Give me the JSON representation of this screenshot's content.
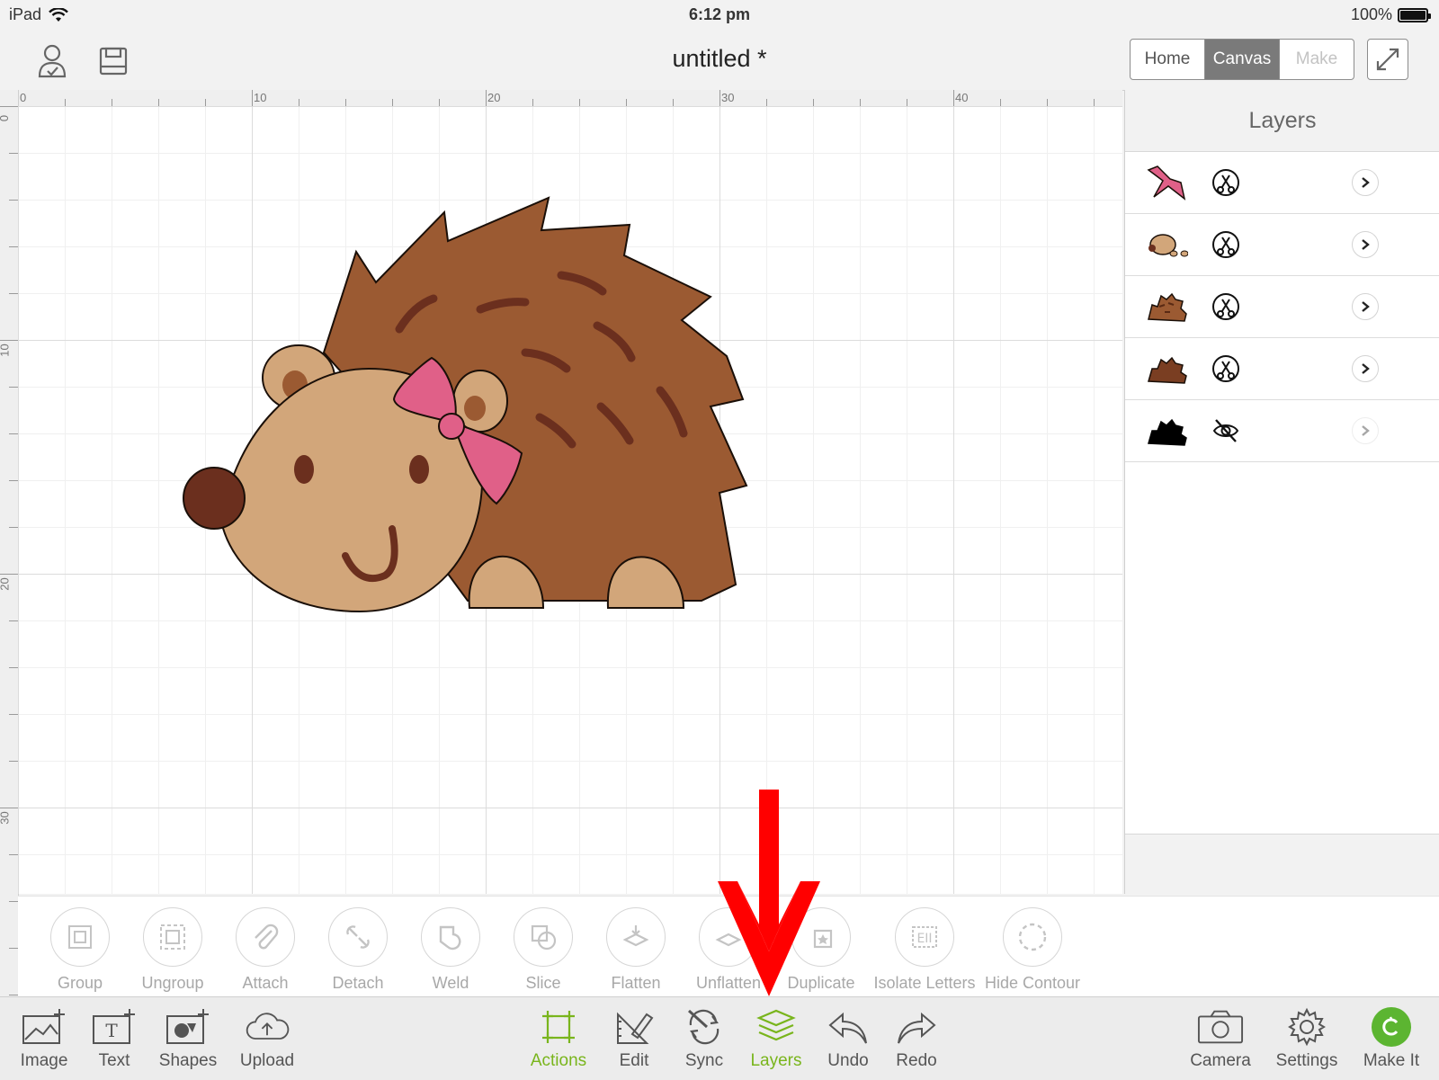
{
  "status": {
    "device": "iPad",
    "time": "6:12 pm",
    "battery": "100%"
  },
  "nav": {
    "title": "untitled *",
    "tabs": [
      {
        "label": "Home"
      },
      {
        "label": "Canvas"
      },
      {
        "label": "Make"
      }
    ],
    "active_tab": "Canvas"
  },
  "ruler": {
    "top": [
      "0",
      "10",
      "20",
      "30",
      "40"
    ],
    "left": [
      "0",
      "10",
      "20",
      "30"
    ]
  },
  "layers": {
    "title": "Layers",
    "items": [
      {
        "thumb": "bow-layer",
        "op": "cut",
        "visible": true,
        "thumb_color": "#e06088"
      },
      {
        "thumb": "face-layer",
        "op": "cut",
        "visible": true,
        "thumb_color": "#d2a67a"
      },
      {
        "thumb": "spikes-detail-layer",
        "op": "cut",
        "visible": true,
        "thumb_color": "#9b5a32"
      },
      {
        "thumb": "body-layer",
        "op": "cut",
        "visible": true,
        "thumb_color": "#7a3e22"
      },
      {
        "thumb": "shadow-layer",
        "op": "hidden",
        "visible": false,
        "thumb_color": "#000000"
      }
    ]
  },
  "actions": [
    {
      "label": "Group",
      "icon": "group-icon"
    },
    {
      "label": "Ungroup",
      "icon": "ungroup-icon"
    },
    {
      "label": "Attach",
      "icon": "paperclip-icon"
    },
    {
      "label": "Detach",
      "icon": "detach-icon"
    },
    {
      "label": "Weld",
      "icon": "weld-icon"
    },
    {
      "label": "Slice",
      "icon": "slice-icon"
    },
    {
      "label": "Flatten",
      "icon": "flatten-icon"
    },
    {
      "label": "Unflatten",
      "icon": "unflatten-icon"
    },
    {
      "label": "Duplicate",
      "icon": "duplicate-icon"
    },
    {
      "label": "Isolate Letters",
      "icon": "isolate-letters-icon"
    },
    {
      "label": "Hide Contour",
      "icon": "hide-contour-icon"
    }
  ],
  "toolbar": {
    "left": [
      {
        "label": "Image",
        "icon": "image-icon"
      },
      {
        "label": "Text",
        "icon": "text-icon"
      },
      {
        "label": "Shapes",
        "icon": "shapes-icon"
      },
      {
        "label": "Upload",
        "icon": "upload-icon"
      }
    ],
    "center": [
      {
        "label": "Actions",
        "icon": "actions-icon",
        "active": true
      },
      {
        "label": "Edit",
        "icon": "edit-icon"
      },
      {
        "label": "Sync",
        "icon": "sync-icon"
      },
      {
        "label": "Layers",
        "icon": "layers-icon",
        "active": true
      },
      {
        "label": "Undo",
        "icon": "undo-icon"
      },
      {
        "label": "Redo",
        "icon": "redo-icon"
      }
    ],
    "right": [
      {
        "label": "Camera",
        "icon": "camera-icon"
      },
      {
        "label": "Settings",
        "icon": "gear-icon"
      },
      {
        "label": "Make It",
        "icon": "make-it-icon"
      }
    ]
  },
  "colors": {
    "accent_green": "#79b51c",
    "annotation_arrow": "#ff0000",
    "hedgehog_body": "#9b5a32",
    "hedgehog_face": "#d2a67a",
    "hedgehog_nose": "#6b2f1e",
    "bow": "#e06088"
  }
}
